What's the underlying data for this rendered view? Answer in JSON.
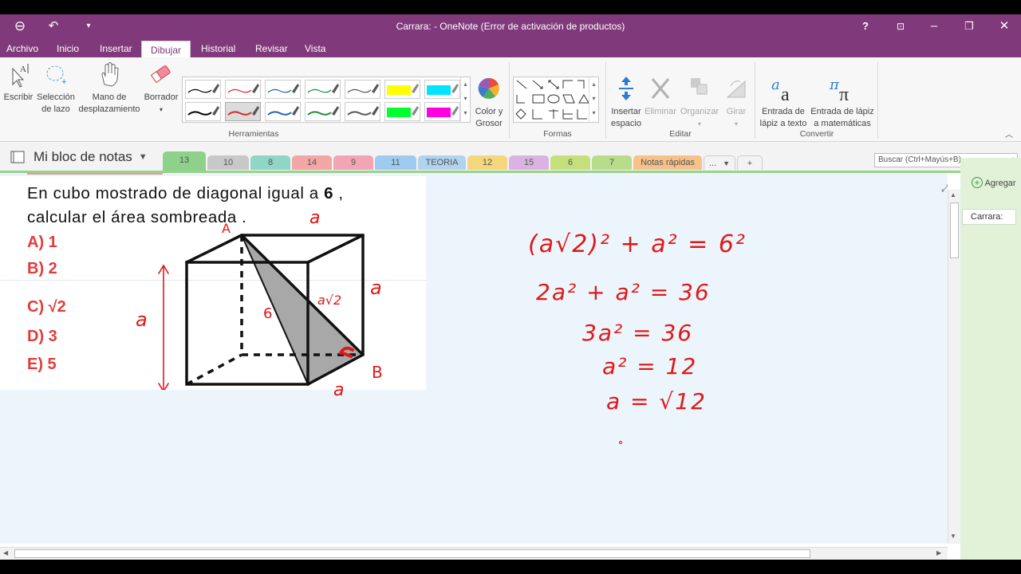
{
  "window": {
    "title": "Carrara: - OneNote (Error de activación de productos)",
    "help": "?"
  },
  "menus": [
    "Archivo",
    "Inicio",
    "Insertar",
    "Dibujar",
    "Historial",
    "Revisar",
    "Vista"
  ],
  "ribbon": {
    "tools": {
      "write": "Escribir",
      "lasso1": "Selección",
      "lasso2": "de lazo",
      "pan1": "Mano de",
      "pan2": "desplazamiento",
      "eraser": "Borrador",
      "group": "Herramientas"
    },
    "color": {
      "l1": "Color y",
      "l2": "Grosor"
    },
    "shapes": {
      "group": "Formas"
    },
    "edit": {
      "insert1": "Insertar",
      "insert2": "espacio",
      "delete": "Eliminar",
      "arrange": "Organizar",
      "rotate": "Girar",
      "group": "Editar"
    },
    "convert": {
      "ink1a": "Entrada de",
      "ink1b": "lápiz a texto",
      "ink2a": "Entrada de lápiz",
      "ink2b": "a matemáticas",
      "group": "Convertir"
    },
    "pen_colors": [
      "#000000",
      "#d82a2a",
      "#2a5fb8",
      "#1f8a3a",
      "#555555",
      "#ffff00",
      "#00e5ff",
      "#000000",
      "#d82a2a",
      "#2a5fb8",
      "#1f8a3a",
      "#555555",
      "#00ff30",
      "#ff00e0"
    ]
  },
  "notebook": {
    "name": "Mi bloc de notas"
  },
  "tabs": [
    {
      "label": "13",
      "color": "#8ed18a"
    },
    {
      "label": "10",
      "color": "#c8c8c8"
    },
    {
      "label": "8",
      "color": "#8fd6c6"
    },
    {
      "label": "14",
      "color": "#f2a6a6"
    },
    {
      "label": "9",
      "color": "#f2a6b4"
    },
    {
      "label": "11",
      "color": "#9ecbef"
    },
    {
      "label": "TEORIA",
      "color": "#b0d3ee"
    },
    {
      "label": "12",
      "color": "#f4d77c"
    },
    {
      "label": "15",
      "color": "#dbb3e3"
    },
    {
      "label": "6",
      "color": "#c3e07d"
    },
    {
      "label": "7",
      "color": "#b7dd8a"
    },
    {
      "label": "Notas rápidas",
      "color": "#f6c28a"
    },
    {
      "label": "...",
      "color": "#f3f3f3"
    },
    {
      "label": "+",
      "color": "#f3f3f3"
    }
  ],
  "search": {
    "placeholder": "Buscar (Ctrl+Mayús+B)"
  },
  "problem": {
    "line1": "En cubo mostrado de diagonal igual a",
    "diag": "6",
    "line2": "calcular el área sombreada .",
    "options": [
      "A) 1",
      "B) 2",
      "C) √2",
      "D) 3",
      "E) 5"
    ]
  },
  "handwriting": {
    "labels": [
      "A",
      "a",
      "a",
      "a",
      "6",
      "a√2",
      "B",
      "a"
    ],
    "eq1": "(a√2)² + a² = 6²",
    "eq2": "2a² + a² = 36",
    "eq3": "3a² = 36",
    "eq4": "a² = 12",
    "eq5": "a = √12"
  },
  "right_pane": {
    "add": "Agregar",
    "page": "Carrara:"
  }
}
